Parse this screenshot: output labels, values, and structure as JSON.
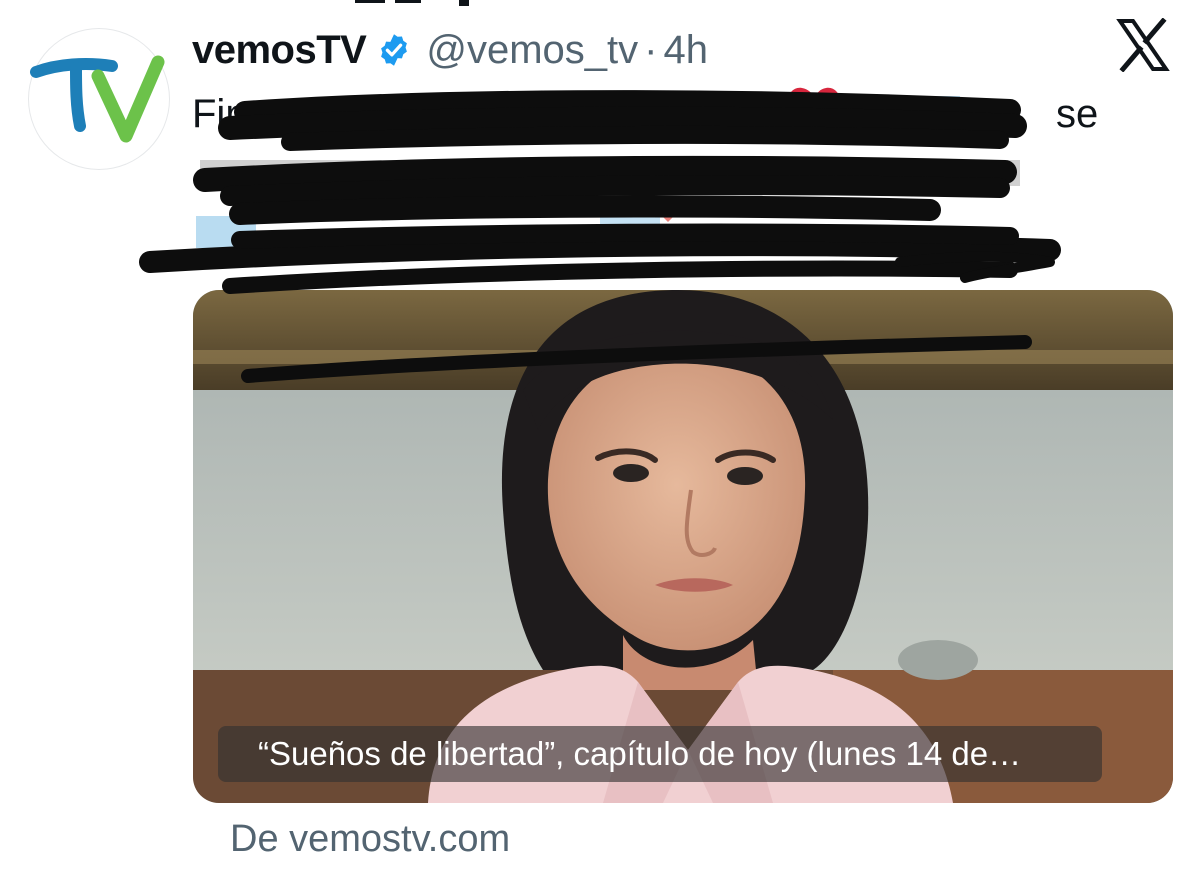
{
  "tweet": {
    "display_name": "vemosTV",
    "handle": "@vemos_tv",
    "separator": "·",
    "time": "4h",
    "verified": true,
    "text_visible_start": "Fina",
    "text_visible_end": "se",
    "text_redacted": true
  },
  "avatar": {
    "logo_text": "TV",
    "colors": {
      "t": "#1e7fb8",
      "v": "#6cc24a"
    }
  },
  "card": {
    "caption": "“Sueños de libertad”, capítulo de hoy (lunes 14 de…",
    "source": "De vemostv.com"
  },
  "icons": {
    "verified": "verified-badge-icon",
    "platform": "x-logo-icon",
    "emoji": "broken-heart-emoji"
  },
  "colors": {
    "text": "#0f1419",
    "secondary": "#536471",
    "link": "#1d9bf0",
    "verified": "#1d9bf0"
  }
}
